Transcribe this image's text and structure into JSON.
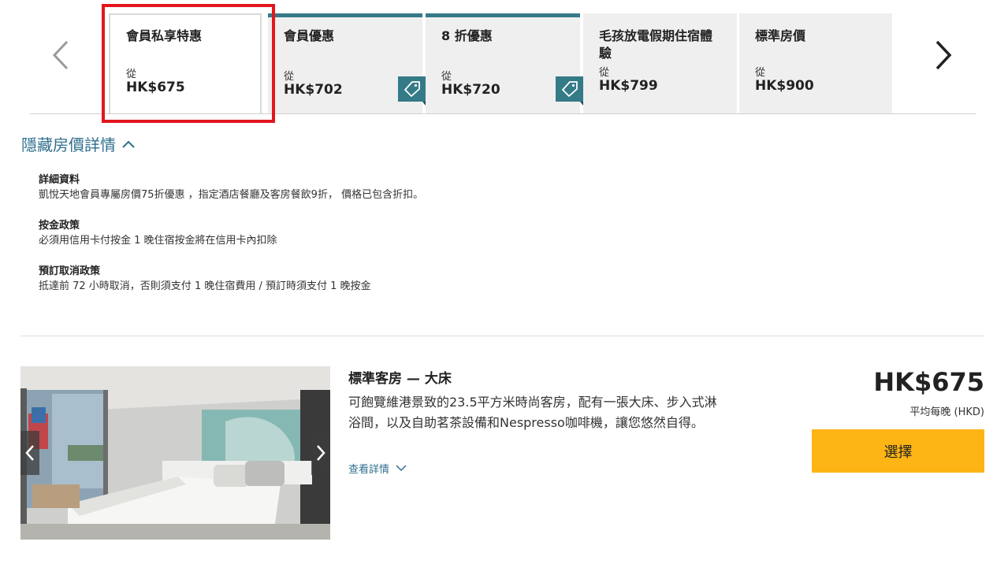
{
  "rate_tabs": [
    {
      "name": "會員私享特惠",
      "from": "從",
      "price": "HK$675",
      "selected": true,
      "tag": false
    },
    {
      "name": "會員優惠",
      "from": "從",
      "price": "HK$702",
      "selected": false,
      "tag": true
    },
    {
      "name": "8 折優惠",
      "from": "從",
      "price": "HK$720",
      "selected": false,
      "tag": true
    },
    {
      "name": "毛孩放電假期住宿體驗",
      "from": "從",
      "price": "HK$799",
      "selected": false,
      "tag": false
    },
    {
      "name": "標準房價",
      "from": "從",
      "price": "HK$900",
      "selected": false,
      "tag": false
    }
  ],
  "icons": {
    "prev": "chevron-left-icon",
    "next": "chevron-right-icon",
    "tag": "price-tag-icon",
    "toggle": "chevron-up-icon",
    "expand": "chevron-down-icon"
  },
  "colors": {
    "accent": "#357a87",
    "link": "#2f6f8f",
    "highlight": "#e3161d",
    "select_button": "#fdb515"
  },
  "rate_details": {
    "toggle_label": "隱藏房價詳情",
    "sections": [
      {
        "title": "詳細資料",
        "text": "凱悅天地會員專屬房價75折優惠 ，指定酒店餐廳及客房餐飲9折， 價格已包含折扣。"
      },
      {
        "title": "按金政策",
        "text": "必須用信用卡付按金 1 晚住宿按金將在信用卡內扣除"
      },
      {
        "title": "預訂取消政策",
        "text": "抵達前 72 小時取消，否則須支付 1 晚住宿費用 / 預訂時須支付 1 晚按金"
      }
    ]
  },
  "room": {
    "title": "標準客房 — 大床",
    "description": "可飽覽維港景致的23.5平方米時尚客房，配有一張大床、步入式淋浴間，以及自助茗茶設備和Nespresso咖啡機，讓您悠然自得。",
    "view_details": "查看詳情",
    "price": "HK$675",
    "price_caption": "平均每晚 (HKD)",
    "select_label": "選擇"
  }
}
